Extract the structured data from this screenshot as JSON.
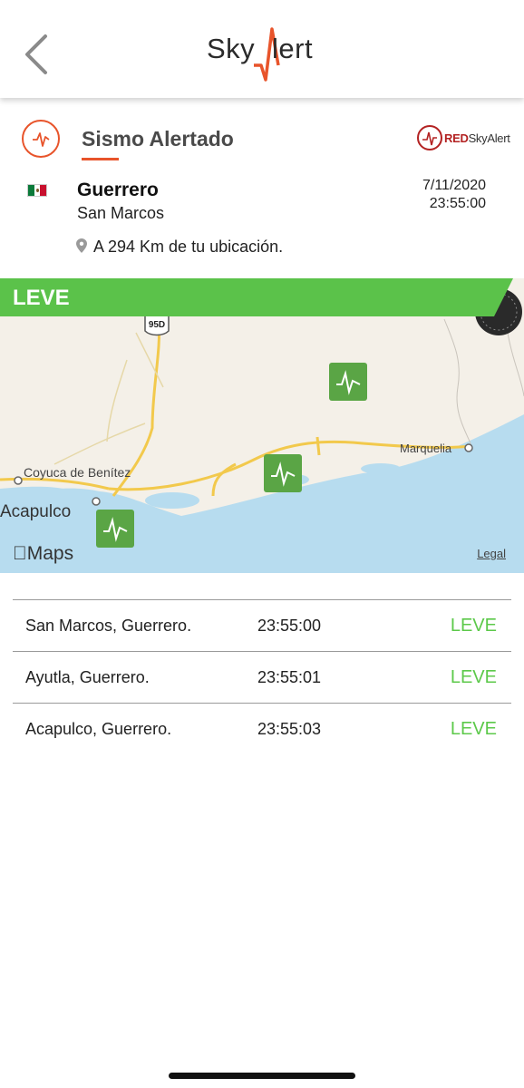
{
  "header": {
    "logo_sky": "Sky",
    "logo_lert": "lert",
    "back_icon": "chevron-left-icon"
  },
  "alert": {
    "title": "Sismo Alertado",
    "partner_brand_red": "RED",
    "partner_brand_rest": "SkyAlert"
  },
  "location": {
    "state": "Guerrero",
    "city": "San Marcos",
    "date": "7/11/2020",
    "time": "23:55:00",
    "distance": "A 294 Km de tu ubicación."
  },
  "map": {
    "level": "LEVE",
    "level_color": "#5bc24a",
    "labels": {
      "highway": "95D",
      "coyuca": "Coyuca de Benítez",
      "acapulco": "Acapulco",
      "marquelia": "Marquelia"
    },
    "maps_logo": "Maps",
    "legal": "Legal"
  },
  "reports": [
    {
      "place": "San Marcos, Guerrero.",
      "time": "23:55:00",
      "level": "LEVE"
    },
    {
      "place": "Ayutla, Guerrero.",
      "time": "23:55:01",
      "level": "LEVE"
    },
    {
      "place": "Acapulco, Guerrero.",
      "time": "23:55:03",
      "level": "LEVE"
    }
  ],
  "colors": {
    "accent": "#e8542b",
    "leve": "#5cc94a",
    "marker": "#5aa545",
    "water": "#b7dcef"
  }
}
